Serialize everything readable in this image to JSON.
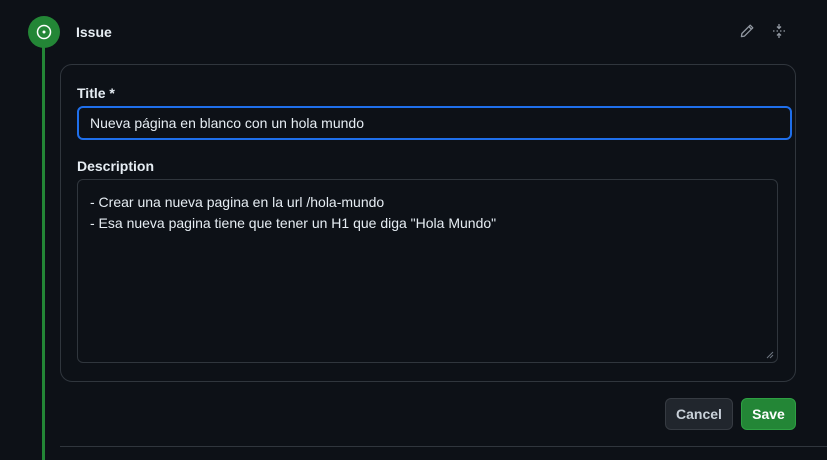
{
  "header": {
    "title": "Issue"
  },
  "form": {
    "title_label": "Title *",
    "title_value": "Nueva página en blanco con un hola mundo",
    "description_label": "Description",
    "description_lines": [
      "- Crear una nueva pagina en la url /hola-mundo",
      "- Esa nueva pagina tiene que tener un H1 que diga \"Hola Mundo\""
    ]
  },
  "actions": {
    "cancel_label": "Cancel",
    "save_label": "Save"
  },
  "icons": {
    "status": "issue-open-icon",
    "edit": "pencil-icon",
    "collapse": "fold-icon"
  },
  "colors": {
    "accent_green": "#238636",
    "focus_blue": "#1f6feb",
    "background": "#0d1117"
  }
}
